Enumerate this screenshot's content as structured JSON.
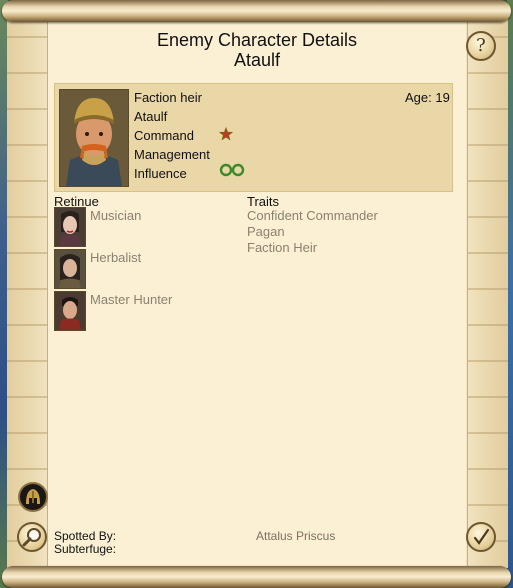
{
  "window": {
    "title_line1": "Enemy Character Details",
    "title_line2": "Ataulf"
  },
  "buttons": {
    "help_glyph": "?",
    "ok_glyph": "✓"
  },
  "character": {
    "label": "Faction heir",
    "name": "Ataulf",
    "age": "Age: 19",
    "attributes": {
      "command": "Command",
      "management": "Management",
      "influence": "Influence"
    }
  },
  "retinue": {
    "heading": "Retinue",
    "items": [
      "Musician",
      "Herbalist",
      "Master Hunter"
    ]
  },
  "traits": {
    "heading": "Traits",
    "items": [
      "Confident Commander",
      "Pagan",
      "Faction Heir"
    ]
  },
  "footer": {
    "spotted_by_label": "Spotted By:",
    "spotted_by_value": "Attalus Priscus",
    "subterfuge_label": "Subterfuge:"
  },
  "colors": {
    "parchment": "#fbf0d4",
    "panel": "#ead7a8",
    "muted_text": "#8a8270",
    "command_star": "#c0392b",
    "influence": "#3a8a2a"
  }
}
